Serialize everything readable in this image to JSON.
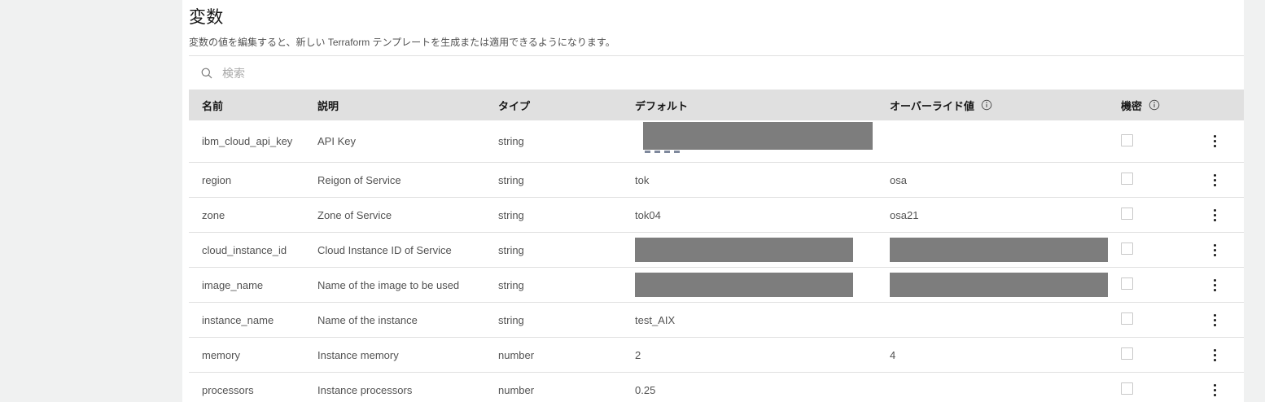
{
  "header": {
    "title": "変数",
    "subtitle": "変数の値を編集すると、新しい Terraform テンプレートを生成または適用できるようになります。"
  },
  "search": {
    "placeholder": "検索"
  },
  "table": {
    "columns": [
      {
        "key": "name",
        "label": "名前",
        "info": false
      },
      {
        "key": "description",
        "label": "説明",
        "info": false
      },
      {
        "key": "type",
        "label": "タイプ",
        "info": false
      },
      {
        "key": "default",
        "label": "デフォルト",
        "info": false
      },
      {
        "key": "override",
        "label": "オーバーライド値",
        "info": true
      },
      {
        "key": "sensitive",
        "label": "機密",
        "info": true
      },
      {
        "key": "actions",
        "label": "",
        "info": false
      }
    ],
    "rows": [
      {
        "name": "ibm_cloud_api_key",
        "description": "API Key",
        "type": "string",
        "default": "",
        "default_redacted": true,
        "override": "",
        "override_redacted": false,
        "sensitive_checked": false,
        "tall": true
      },
      {
        "name": "region",
        "description": "Reigon of Service",
        "type": "string",
        "default": "tok",
        "default_redacted": false,
        "override": "osa",
        "override_redacted": false,
        "sensitive_checked": false,
        "tall": false
      },
      {
        "name": "zone",
        "description": "Zone of Service",
        "type": "string",
        "default": "tok04",
        "default_redacted": false,
        "override": "osa21",
        "override_redacted": false,
        "sensitive_checked": false,
        "tall": false
      },
      {
        "name": "cloud_instance_id",
        "description": "Cloud Instance ID of Service",
        "type": "string",
        "default": "",
        "default_redacted": true,
        "override": "",
        "override_redacted": true,
        "sensitive_checked": false,
        "tall": false
      },
      {
        "name": "image_name",
        "description": "Name of the image to be used",
        "type": "string",
        "default": "",
        "default_redacted": true,
        "override": "",
        "override_redacted": true,
        "sensitive_checked": false,
        "tall": false
      },
      {
        "name": "instance_name",
        "description": "Name of the instance",
        "type": "string",
        "default": "test_AIX",
        "default_redacted": false,
        "override": "",
        "override_redacted": false,
        "sensitive_checked": false,
        "tall": false
      },
      {
        "name": "memory",
        "description": "Instance memory",
        "type": "number",
        "default": "2",
        "default_redacted": false,
        "override": "4",
        "override_redacted": false,
        "sensitive_checked": false,
        "tall": false
      },
      {
        "name": "processors",
        "description": "Instance processors",
        "type": "number",
        "default": "0.25",
        "default_redacted": false,
        "override": "",
        "override_redacted": false,
        "sensitive_checked": false,
        "tall": false
      }
    ]
  },
  "icons": {
    "search": "search-icon",
    "info": "info-icon",
    "overflow": "overflow-menu-icon"
  },
  "colors": {
    "page_background": "#f0f1f1",
    "content_background": "#ffffff",
    "table_header_background": "#e0e0e0",
    "row_border": "#e0e0e0",
    "heading_text": "#161616",
    "body_text": "#525252",
    "redaction_block": "#7d7d7d",
    "placeholder_text": "#a8a8a8"
  }
}
